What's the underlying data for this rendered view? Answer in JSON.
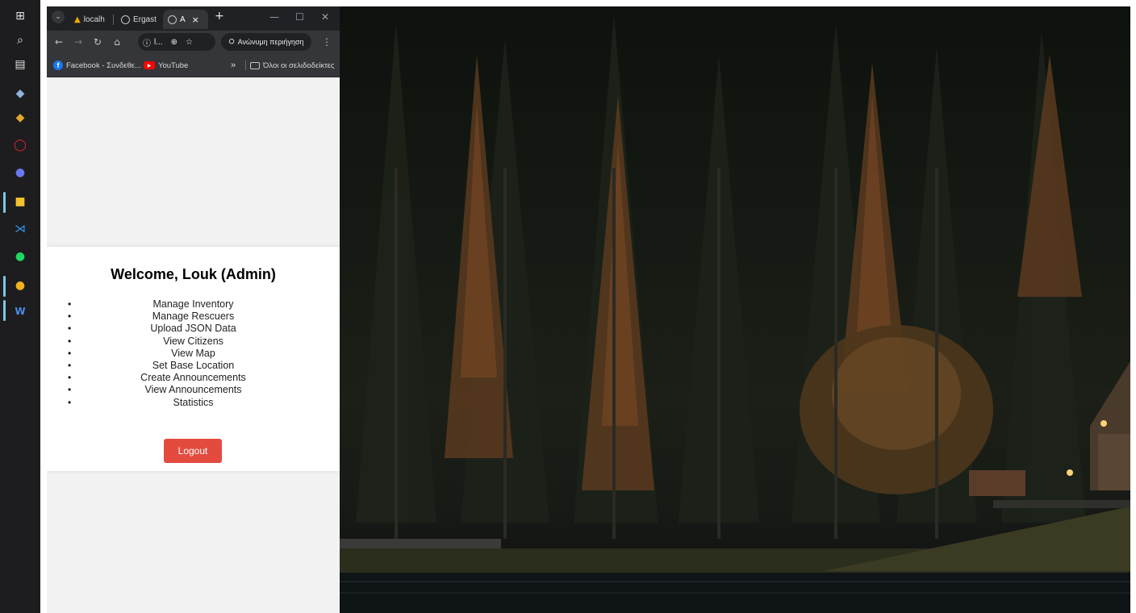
{
  "taskbar": {
    "icons": [
      {
        "name": "start-icon",
        "glyph": "⊞"
      },
      {
        "name": "search-icon",
        "glyph": "⌕"
      },
      {
        "name": "task-view-icon",
        "glyph": "▤"
      },
      {
        "name": "app-icon-1",
        "glyph": "◆"
      },
      {
        "name": "app-icon-2",
        "glyph": "◆"
      },
      {
        "name": "opera-icon",
        "glyph": "◯"
      },
      {
        "name": "discord-icon",
        "glyph": "●"
      },
      {
        "name": "file-explorer-icon",
        "glyph": "■"
      },
      {
        "name": "vscode-icon",
        "glyph": "⋊"
      },
      {
        "name": "spotify-icon",
        "glyph": "●"
      },
      {
        "name": "chrome-icon",
        "glyph": "●"
      },
      {
        "name": "word-icon",
        "glyph": "W"
      }
    ]
  },
  "browser": {
    "tabs": [
      {
        "label": "localh"
      },
      {
        "label": "Ergast"
      },
      {
        "label": "A"
      }
    ],
    "tab_close": "×",
    "new_tab": "+",
    "window_controls": {
      "minimize": "—",
      "maximize": "☐",
      "close": "✕"
    },
    "omnibox_text": "l...",
    "incognito_label": "Ανώνυμη περιήγηση",
    "bookmarks": [
      {
        "label": "Facebook - Συνδεθε..."
      },
      {
        "label": "YouTube"
      }
    ],
    "bookmarks_overflow": "»",
    "all_bookmarks_label": "Όλοι οι σελιδοδείκτες"
  },
  "page": {
    "welcome": "Welcome, Louk (Admin)",
    "menu_items": [
      "Manage Inventory",
      "Manage Rescuers",
      "Upload JSON Data",
      "View Citizens",
      "View Map",
      "Set Base Location",
      "Create Announcements",
      "View Announcements",
      "Statistics"
    ],
    "logout_label": "Logout"
  },
  "colors": {
    "logout_button": "#e34b3f",
    "tabstrip": "#202124",
    "toolbar": "#35363a",
    "page_background": "#f2f2f2",
    "facebook": "#1877f2",
    "youtube": "#ff0000"
  }
}
